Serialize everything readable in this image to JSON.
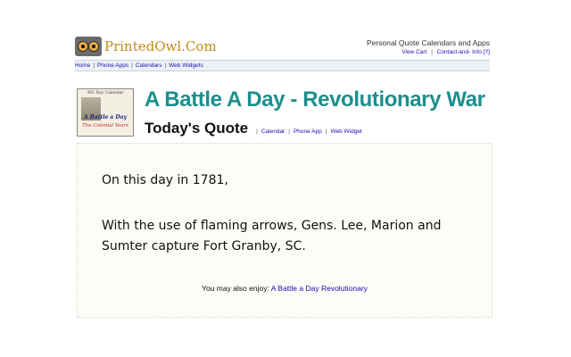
{
  "header": {
    "logo_text": "PrintedOwl.Com",
    "tagline": "Personal Quote Calendars and Apps",
    "view_cart": "View Cart",
    "contact": "Contact-and- Info",
    "help": "[?]"
  },
  "nav": {
    "items": [
      "Home",
      "Phone Apps",
      "Calendars",
      "Web Widgets"
    ]
  },
  "book": {
    "top_text": "365 Day Calendar",
    "title": "A Battle a Day",
    "subtitle": "The Colonial Years"
  },
  "page": {
    "title": "A Battle A Day - Revolutionary War",
    "subtitle": "Today's Quote",
    "links": [
      "Calendar",
      "Phone App",
      "Web Widget"
    ]
  },
  "quote": {
    "line1": "On this day in 1781,",
    "line2": "With the use of flaming arrows, Gens. Lee, Marion and Sumter capture Fort Granby, SC.",
    "enjoy_label": "You may also enjoy:",
    "enjoy_link": "A Battle a Day Revolutionary"
  },
  "colors": {
    "title": "#1b8f8e",
    "logo": "#c48a1a",
    "link": "#1a0dab"
  }
}
